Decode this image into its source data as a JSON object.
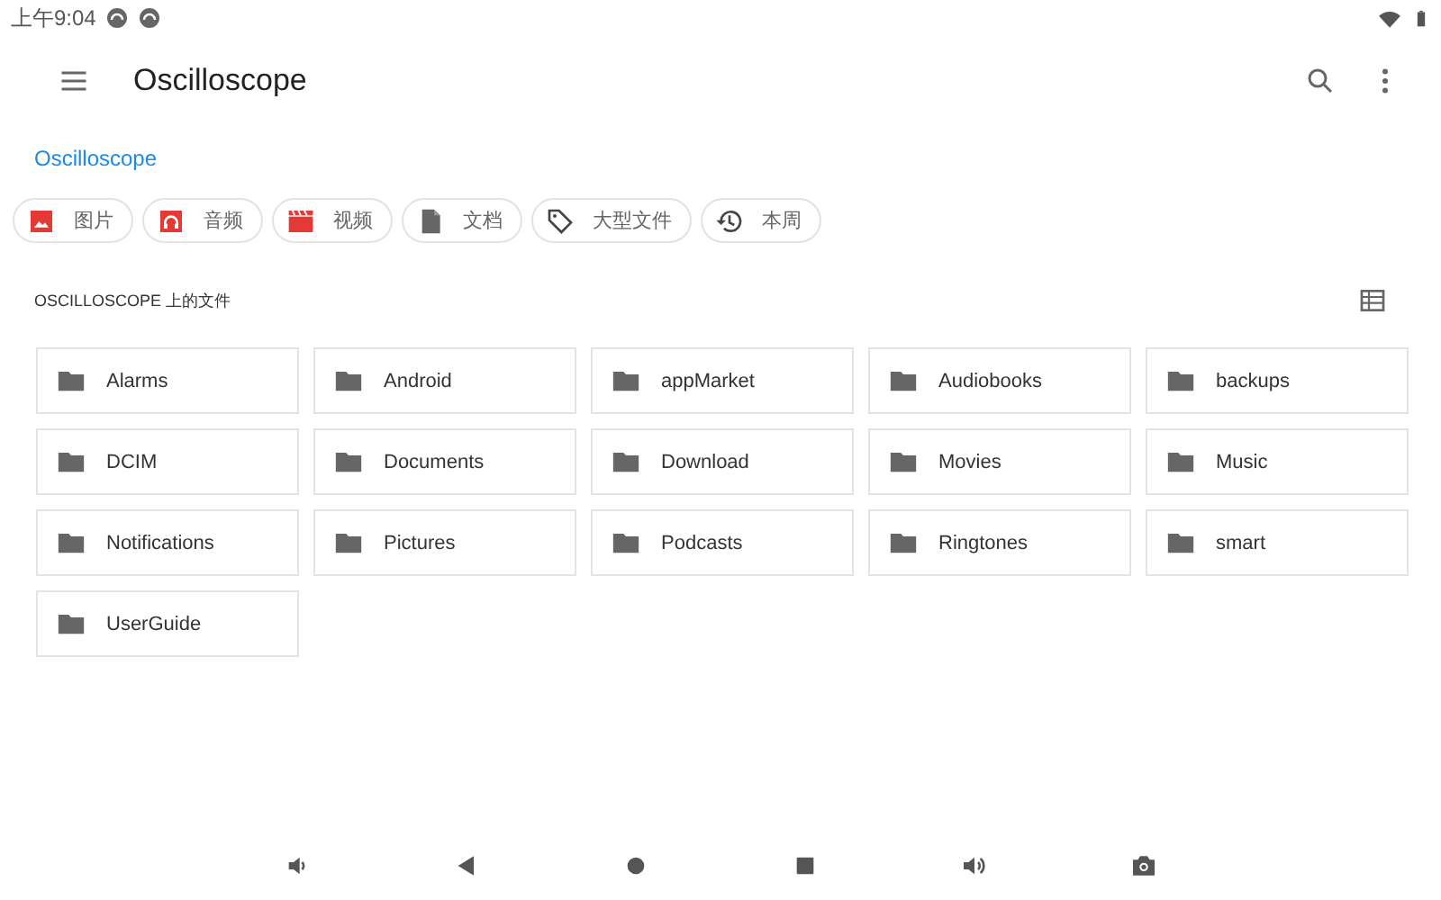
{
  "status_bar": {
    "time": "上午9:04"
  },
  "toolbar": {
    "title": "Oscilloscope"
  },
  "breadcrumb": "Oscilloscope",
  "chips": [
    {
      "label": "图片",
      "kind": "image"
    },
    {
      "label": "音频",
      "kind": "audio"
    },
    {
      "label": "视频",
      "kind": "video"
    },
    {
      "label": "文档",
      "kind": "document"
    },
    {
      "label": "大型文件",
      "kind": "large"
    },
    {
      "label": "本周",
      "kind": "recent"
    }
  ],
  "section_title": "OSCILLOSCOPE 上的文件",
  "folders": [
    {
      "name": "Alarms"
    },
    {
      "name": "Android"
    },
    {
      "name": "appMarket"
    },
    {
      "name": "Audiobooks"
    },
    {
      "name": "backups"
    },
    {
      "name": "DCIM"
    },
    {
      "name": "Documents"
    },
    {
      "name": "Download"
    },
    {
      "name": "Movies"
    },
    {
      "name": "Music"
    },
    {
      "name": "Notifications"
    },
    {
      "name": "Pictures"
    },
    {
      "name": "Podcasts"
    },
    {
      "name": "Ringtones"
    },
    {
      "name": "smart"
    },
    {
      "name": "UserGuide"
    }
  ]
}
